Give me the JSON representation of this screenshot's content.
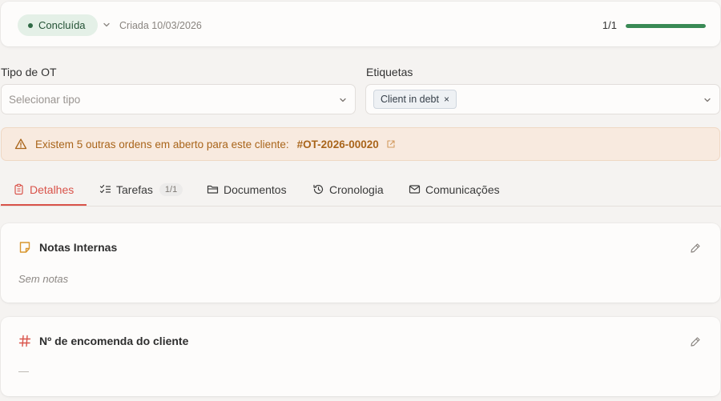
{
  "header": {
    "status_label": "Concluída",
    "created_text": "Criada 10/03/2026",
    "progress_label": "1/1",
    "progress_fraction": 1.0,
    "colors": {
      "status_bg": "#e4f0e7",
      "progress": "#3a8a55"
    }
  },
  "fields": {
    "type_label": "Tipo de OT",
    "type_placeholder": "Selecionar tipo",
    "tags_label": "Etiquetas",
    "tags": [
      "Client in debt"
    ]
  },
  "alert": {
    "message": "Existem 5 outras ordens em aberto para este cliente:",
    "link": "#OT-2026-00020",
    "icon": "warning-triangle-icon"
  },
  "tabs": [
    {
      "label": "Detalhes",
      "icon": "clipboard-icon",
      "active": true
    },
    {
      "label": "Tarefas",
      "icon": "checklist-icon",
      "badge": "1/1"
    },
    {
      "label": "Documentos",
      "icon": "folder-icon"
    },
    {
      "label": "Cronologia",
      "icon": "history-icon"
    },
    {
      "label": "Comunicações",
      "icon": "mail-icon"
    }
  ],
  "sections": {
    "notes": {
      "title": "Notas Internas",
      "empty_text": "Sem notas"
    },
    "order_number": {
      "title": "Nº de encomenda do cliente",
      "empty_text": "—"
    }
  },
  "accent_color": "#d9534a"
}
